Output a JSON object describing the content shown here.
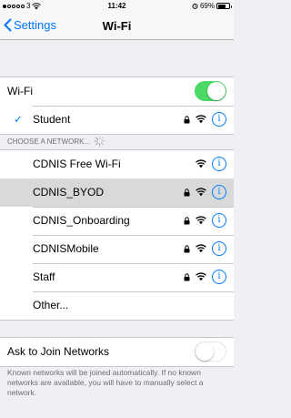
{
  "status_bar": {
    "carrier": "3",
    "time": "11:42",
    "battery": "69%",
    "battery_level": 0.69
  },
  "nav": {
    "back_label": "Settings",
    "title": "Wi-Fi"
  },
  "wifi_toggle": {
    "label": "Wi-Fi",
    "on": true
  },
  "current_network": {
    "name": "Student",
    "secured": true
  },
  "choose_header": "CHOOSE A NETWORK...",
  "networks": [
    {
      "name": "CDNIS Free Wi-Fi",
      "secured": false,
      "selected": false
    },
    {
      "name": "CDNIS_BYOD",
      "secured": true,
      "selected": true
    },
    {
      "name": "CDNIS_Onboarding",
      "secured": true,
      "selected": false
    },
    {
      "name": "CDNISMobile",
      "secured": true,
      "selected": false
    },
    {
      "name": "Staff",
      "secured": true,
      "selected": false
    }
  ],
  "other_label": "Other...",
  "ask_to_join": {
    "label": "Ask to Join Networks",
    "on": false,
    "footer": "Known networks will be joined automatically. If no known networks are available, you will have to manually select a network."
  },
  "colors": {
    "accent": "#007aff",
    "toggle_on": "#4cd964",
    "background": "#efeff4"
  }
}
